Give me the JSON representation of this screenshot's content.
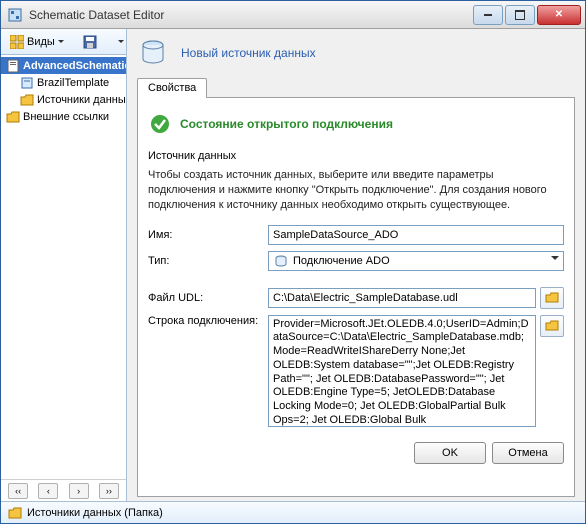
{
  "window": {
    "title": "Schematic Dataset Editor"
  },
  "toolbar": {
    "views_label": "Виды"
  },
  "tree": {
    "items": [
      {
        "label": "AdvancedSchematic",
        "selected": true
      },
      {
        "label": "BrazilTemplate"
      },
      {
        "label": "Источники данных"
      },
      {
        "label": "Внешние ссылки"
      }
    ]
  },
  "header": {
    "new_source_link": "Новый источник данных"
  },
  "tabs": {
    "properties": "Свойства"
  },
  "status": {
    "open_connection": "Состояние открытого подключения"
  },
  "form": {
    "section_label": "Источник данных",
    "help_text": "Чтобы создать источник данных, выберите или введите параметры подключения и нажмите кнопку \"Открыть подключение\". Для создания нового подключения к источнику данных необходимо открыть существующее.",
    "name_label": "Имя:",
    "name_value": "SampleDataSource_ADO",
    "type_label": "Тип:",
    "type_value": "Подключение ADO",
    "udl_label": "Файл UDL:",
    "udl_value": "C:\\Data\\Electric_SampleDatabase.udl",
    "connstr_label": "Строка подключения:",
    "connstr_value": "Provider=Microsoft.JEt.OLEDB.4.0;UserID=Admin;DataSource=C:\\Data\\Electric_SampleDatabase.mdb;Mode=ReadWriteIShareDerry None;Jet OLEDB:System database=\"\";Jet OLEDB:Registry Path=\"\"; Jet OLEDB:DatabasePassword=\"\"; Jet OLEDB:Engine Type=5; JetOLEDB:Database Locking Mode=0; Jet OLEDB:GlobalPartial Bulk Ops=2; Jet OLEDB:Global Bulk"
  },
  "buttons": {
    "ok": "OK",
    "cancel": "Отмена"
  },
  "statusbar": {
    "text": "Источники данных (Папка)"
  }
}
